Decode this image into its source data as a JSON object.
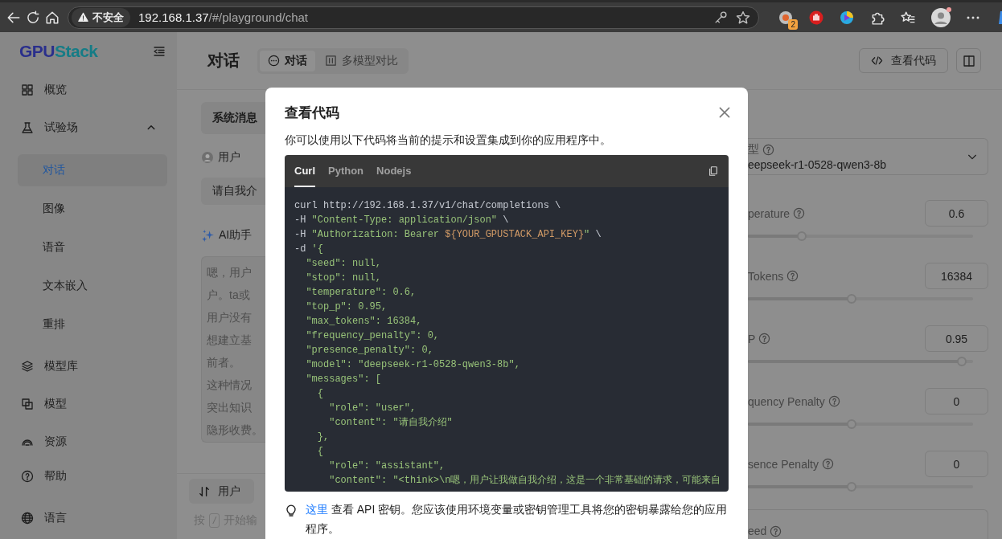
{
  "browser": {
    "security": "不安全",
    "url_host": "192.168.1.37",
    "url_path": "/#/playground/chat",
    "extension_badge": "2"
  },
  "sidebar": {
    "logo": "GPUStack",
    "items": [
      {
        "label": "概览"
      },
      {
        "label": "试验场",
        "expanded": true,
        "children": [
          {
            "label": "对话",
            "selected": true
          },
          {
            "label": "图像",
            "selected": false
          },
          {
            "label": "语音",
            "selected": false
          },
          {
            "label": "文本嵌入",
            "selected": false
          },
          {
            "label": "重排",
            "selected": false
          }
        ]
      },
      {
        "label": "模型库"
      },
      {
        "label": "模型"
      },
      {
        "label": "资源"
      }
    ],
    "footer": [
      {
        "label": "帮助"
      },
      {
        "label": "语言"
      }
    ]
  },
  "header": {
    "title": "对话",
    "tabs": [
      {
        "label": "对话",
        "selected": true
      },
      {
        "label": "多模型对比",
        "selected": false
      }
    ],
    "view_code_button": "查看代码"
  },
  "chat": {
    "system_tab": "系统消息",
    "user_label": "用户",
    "user_message": "请自我介",
    "assistant_label": "AI助手",
    "reply_lines": [
      "嗯，用户",
      "户。ta或",
      "用户没有",
      "想建立基",
      "前者。",
      "这种情况",
      "突出知识",
      "隐形收费。"
    ],
    "role_button": "用户",
    "hint_prefix": "按",
    "hint_key": "/",
    "hint_text": "开始输"
  },
  "params": {
    "model_label": "型",
    "model_value": "eepseek-r1-0528-qwen3-8b",
    "sliders": [
      {
        "label": "perature",
        "value": "0.6",
        "level": 0.24
      },
      {
        "label": "Tokens",
        "value": "16384",
        "level": 0.46
      },
      {
        "label": "P",
        "value": "0.95",
        "level": 0.95
      },
      {
        "label": "quency Penalty",
        "value": "0",
        "level": 0.46
      },
      {
        "label": "sence Penalty",
        "value": "0",
        "level": 0.46
      }
    ],
    "seed_label": "eed"
  },
  "modal": {
    "title": "查看代码",
    "description": "你可以使用以下代码将当前的提示和设置集成到你的应用程序中。",
    "code_tabs": [
      {
        "label": "Curl",
        "selected": true
      },
      {
        "label": "Python",
        "selected": false
      },
      {
        "label": "Nodejs",
        "selected": false
      }
    ],
    "code_lines": [
      [
        {
          "kind": "plain",
          "text": "curl http://192.168.1.37/v1/chat/completions \\"
        }
      ],
      [
        {
          "kind": "plain",
          "text": "-H "
        },
        {
          "kind": "string",
          "text": "\"Content-Type: application/json\""
        },
        {
          "kind": "plain",
          "text": " \\"
        }
      ],
      [
        {
          "kind": "plain",
          "text": "-H "
        },
        {
          "kind": "string",
          "text": "\"Authorization: Bearer "
        },
        {
          "kind": "variable",
          "text": "${YOUR_GPUSTACK_API_KEY}"
        },
        {
          "kind": "string",
          "text": "\""
        },
        {
          "kind": "plain",
          "text": " \\"
        }
      ],
      [
        {
          "kind": "plain",
          "text": "-d "
        },
        {
          "kind": "string",
          "text": "'{"
        }
      ],
      [
        {
          "kind": "string",
          "text": "  \"seed\": null,"
        }
      ],
      [
        {
          "kind": "string",
          "text": "  \"stop\": null,"
        }
      ],
      [
        {
          "kind": "string",
          "text": "  \"temperature\": 0.6,"
        }
      ],
      [
        {
          "kind": "string",
          "text": "  \"top_p\": 0.95,"
        }
      ],
      [
        {
          "kind": "string",
          "text": "  \"max_tokens\": 16384,"
        }
      ],
      [
        {
          "kind": "string",
          "text": "  \"frequency_penalty\": 0,"
        }
      ],
      [
        {
          "kind": "string",
          "text": "  \"presence_penalty\": 0,"
        }
      ],
      [
        {
          "kind": "string",
          "text": "  \"model\": \"deepseek-r1-0528-qwen3-8b\","
        }
      ],
      [
        {
          "kind": "string",
          "text": "  \"messages\": ["
        }
      ],
      [
        {
          "kind": "string",
          "text": "    {"
        }
      ],
      [
        {
          "kind": "string",
          "text": "      \"role\": \"user\","
        }
      ],
      [
        {
          "kind": "string",
          "text": "      \"content\": \"请自我介绍\""
        }
      ],
      [
        {
          "kind": "string",
          "text": "    },"
        }
      ],
      [
        {
          "kind": "string",
          "text": "    {"
        }
      ],
      [
        {
          "kind": "string",
          "text": "      \"role\": \"assistant\","
        }
      ],
      [
        {
          "kind": "string",
          "text": "      \"content\": \"<think>\\n嗯，用户让我做自我介绍，这是一个非常基础的请求，可能来自"
        }
      ]
    ],
    "note_link": "这里",
    "note_text": " 查看 API 密钥。您应该使用环境变量或密钥管理工具将您的密钥暴露给您的应用程序。"
  }
}
